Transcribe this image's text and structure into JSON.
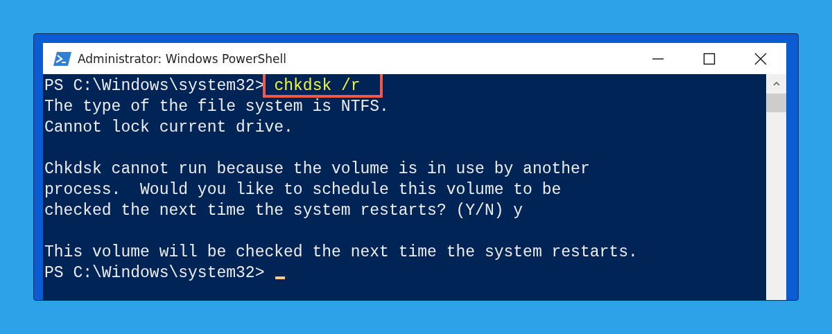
{
  "window": {
    "title": "Administrator: Windows PowerShell"
  },
  "terminal": {
    "lines": [
      {
        "kind": "prompt",
        "prompt": "PS C:\\Windows\\system32>",
        "command": "chkdsk /r",
        "highlighted": true
      },
      {
        "kind": "output",
        "text": "The type of the file system is NTFS."
      },
      {
        "kind": "output",
        "text": "Cannot lock current drive."
      },
      {
        "kind": "blank"
      },
      {
        "kind": "output",
        "text": "Chkdsk cannot run because the volume is in use by another"
      },
      {
        "kind": "output",
        "text": "process.  Would you like to schedule this volume to be"
      },
      {
        "kind": "output",
        "text": "checked the next time the system restarts? (Y/N) y"
      },
      {
        "kind": "blank"
      },
      {
        "kind": "output",
        "text": "This volume will be checked the next time the system restarts."
      },
      {
        "kind": "prompt",
        "prompt": "PS C:\\Windows\\system32>",
        "cursor": true
      }
    ]
  }
}
